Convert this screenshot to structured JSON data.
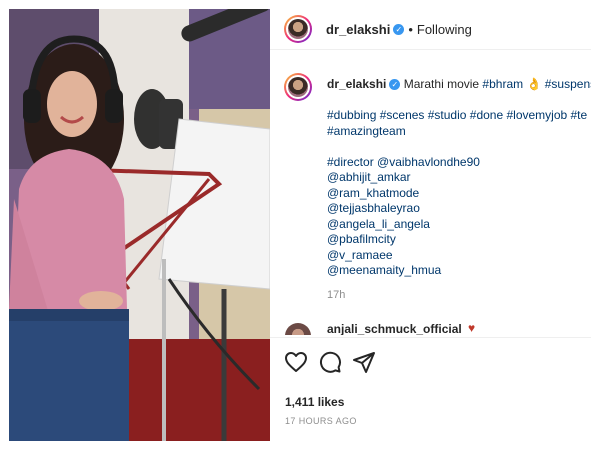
{
  "post": {
    "username": "dr_elakshi",
    "follow_status": "Following",
    "separator": "•",
    "verified_glyph": "✓"
  },
  "caption": {
    "username": "dr_elakshi",
    "first_line_text": "Marathi movie ",
    "first_line_tags": [
      "#bhram",
      "👌",
      "#suspense"
    ],
    "line2": "#dubbing #scenes #studio #done #lovemyjob #te",
    "line3": "#amazingteam",
    "director_tag": "#director",
    "director_mention": "@vaibhavlondhe90",
    "mentions": [
      "@abhijit_amkar",
      "@ram_khatmode",
      "@tejjasbhaleyrao",
      "@angela_li_angela",
      "@pbafilmcity",
      "@v_ramaee",
      "@meenamaity_hmua"
    ],
    "time": "17h"
  },
  "comment": {
    "username": "anjali_schmuck_official",
    "emoji": "♥"
  },
  "actions": {
    "like_icon": "heart-outline-icon",
    "comment_icon": "comment-bubble-icon",
    "share_icon": "paper-plane-icon"
  },
  "stats": {
    "likes": "1,411 likes",
    "posted": "17 HOURS AGO"
  }
}
